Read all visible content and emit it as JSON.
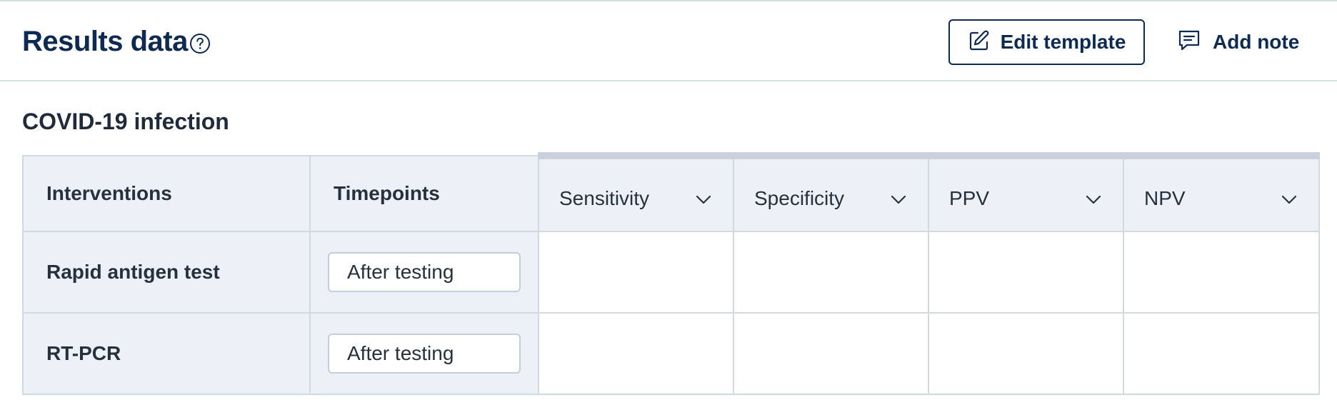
{
  "header": {
    "title": "Results data",
    "help_icon": "question-circle-icon",
    "edit_button_label": "Edit template",
    "edit_icon": "pencil-square-icon",
    "note_button_label": "Add note",
    "note_icon": "comment-icon"
  },
  "section": {
    "title": "COVID-19 infection"
  },
  "table": {
    "col_interventions": "Interventions",
    "col_timepoints": "Timepoints",
    "metrics": [
      {
        "label": "Sensitivity"
      },
      {
        "label": "Specificity"
      },
      {
        "label": "PPV"
      },
      {
        "label": "NPV"
      }
    ],
    "rows": [
      {
        "intervention": "Rapid antigen test",
        "timepoint": "After testing"
      },
      {
        "intervention": "RT-PCR",
        "timepoint": "After testing"
      }
    ]
  },
  "colors": {
    "brand_navy": "#0e2a52",
    "header_bg": "#edf1f7",
    "border": "#d3d9e1"
  }
}
